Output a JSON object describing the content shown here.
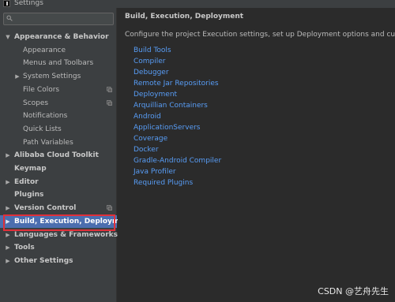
{
  "window": {
    "title": "Settings"
  },
  "search": {
    "placeholder": ""
  },
  "tree": {
    "items": [
      {
        "label": "Appearance & Behavior",
        "bold": true,
        "expanded": true,
        "level": 0
      },
      {
        "label": "Appearance",
        "bold": false,
        "level": 1
      },
      {
        "label": "Menus and Toolbars",
        "bold": false,
        "level": 1
      },
      {
        "label": "System Settings",
        "bold": false,
        "collapsed": true,
        "level": 1
      },
      {
        "label": "File Colors",
        "bold": false,
        "level": 1,
        "project_icon": true
      },
      {
        "label": "Scopes",
        "bold": false,
        "level": 1,
        "project_icon": true
      },
      {
        "label": "Notifications",
        "bold": false,
        "level": 1
      },
      {
        "label": "Quick Lists",
        "bold": false,
        "level": 1
      },
      {
        "label": "Path Variables",
        "bold": false,
        "level": 1
      },
      {
        "label": "Alibaba Cloud Toolkit",
        "bold": true,
        "collapsed": true,
        "level": 0
      },
      {
        "label": "Keymap",
        "bold": true,
        "level": 0
      },
      {
        "label": "Editor",
        "bold": true,
        "collapsed": true,
        "level": 0
      },
      {
        "label": "Plugins",
        "bold": true,
        "level": 0
      },
      {
        "label": "Version Control",
        "bold": true,
        "collapsed": true,
        "level": 0,
        "project_icon": true
      },
      {
        "label": "Build, Execution, Deployment",
        "bold": true,
        "collapsed": true,
        "level": 0,
        "selected": true
      },
      {
        "label": "Languages & Frameworks",
        "bold": true,
        "collapsed": true,
        "level": 0
      },
      {
        "label": "Tools",
        "bold": true,
        "collapsed": true,
        "level": 0
      },
      {
        "label": "Other Settings",
        "bold": true,
        "collapsed": true,
        "level": 0
      }
    ]
  },
  "content": {
    "title": "Build, Execution, Deployment",
    "description": "Configure the project Execution settings, set up Deployment options and customize the",
    "links": [
      "Build Tools",
      "Compiler",
      "Debugger",
      "Remote Jar Repositories",
      "Deployment",
      "Arquillian Containers",
      "Android",
      "ApplicationServers",
      "Coverage",
      "Docker",
      "Gradle-Android Compiler",
      "Java Profiler",
      "Required Plugins"
    ]
  },
  "watermark": "CSDN @艺舟先生",
  "colors": {
    "link": "#589df6",
    "selection": "#4b6eaf",
    "highlight_border": "#e0303a",
    "panel_bg": "#3c3f41",
    "content_bg": "#2b2b2b"
  }
}
